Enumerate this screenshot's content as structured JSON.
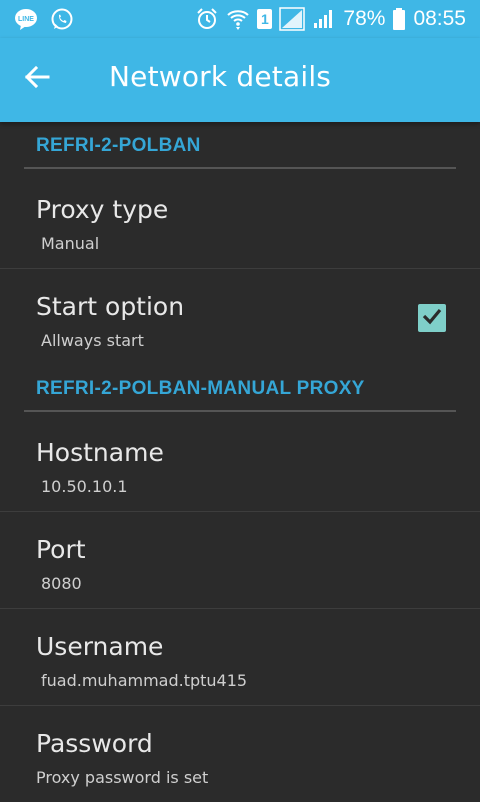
{
  "status_bar": {
    "left_icons": [
      "line-icon",
      "whatsapp-icon"
    ],
    "right_icons": [
      "alarm-icon",
      "wifi-icon",
      "sim-icon",
      "signal-icon",
      "battery-icon"
    ],
    "sim_label": "1",
    "battery": "78%",
    "time": "08:55"
  },
  "app_bar": {
    "title": "Network details",
    "back_icon": "back-arrow-icon",
    "color": "#3fb7e6"
  },
  "sections": {
    "network": {
      "header": "REFRI-2-POLBAN",
      "proxy_type": {
        "title": "Proxy type",
        "summary": "Manual"
      },
      "start_option": {
        "title": "Start option",
        "summary": "Allways start",
        "checked": true
      }
    },
    "manual_proxy": {
      "header": "REFRI-2-POLBAN-MANUAL PROXY",
      "hostname": {
        "title": "Hostname",
        "summary": "10.50.10.1"
      },
      "port": {
        "title": "Port",
        "summary": "8080"
      },
      "username": {
        "title": "Username",
        "summary": "fuad.muhammad.tptu415"
      },
      "password": {
        "title": "Password",
        "summary": "Proxy password is set"
      }
    }
  },
  "colors": {
    "accent": "#35a6d6",
    "background": "#2b2b2b",
    "checkbox": "#7fcfc9"
  }
}
